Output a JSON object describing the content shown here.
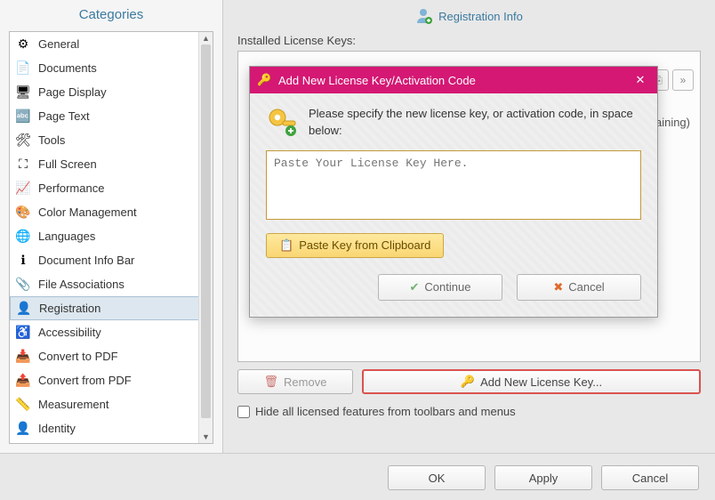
{
  "sidebar": {
    "title": "Categories",
    "items": [
      {
        "label": "General",
        "icon": "⚙"
      },
      {
        "label": "Documents",
        "icon": "📄"
      },
      {
        "label": "Page Display",
        "icon": "🖥"
      },
      {
        "label": "Page Text",
        "icon": "🔤"
      },
      {
        "label": "Tools",
        "icon": "🛠"
      },
      {
        "label": "Full Screen",
        "icon": "⛶"
      },
      {
        "label": "Performance",
        "icon": "📈"
      },
      {
        "label": "Color Management",
        "icon": "🎨"
      },
      {
        "label": "Languages",
        "icon": "🌐"
      },
      {
        "label": "Document Info Bar",
        "icon": "ℹ"
      },
      {
        "label": "File Associations",
        "icon": "📎"
      },
      {
        "label": "Registration",
        "icon": "👤",
        "selected": true
      },
      {
        "label": "Accessibility",
        "icon": "♿"
      },
      {
        "label": "Convert to PDF",
        "icon": "📥"
      },
      {
        "label": "Convert from PDF",
        "icon": "📤"
      },
      {
        "label": "Measurement",
        "icon": "📏"
      },
      {
        "label": "Identity",
        "icon": "👤"
      }
    ]
  },
  "main": {
    "title": "Registration Info",
    "installed_label": "Installed License Keys:",
    "status_text": "aining)",
    "remove_label": "Remove",
    "add_key_label": "Add New License Key...",
    "hide_checkbox_label": "Hide all licensed features from toolbars and menus"
  },
  "modal": {
    "title": "Add New License Key/Activation Code",
    "message": "Please specify the new license key, or activation code, in space below:",
    "placeholder": "Paste Your License Key Here.",
    "paste_label": "Paste Key from Clipboard",
    "continue_label": "Continue",
    "cancel_label": "Cancel"
  },
  "footer": {
    "ok": "OK",
    "apply": "Apply",
    "cancel": "Cancel"
  }
}
